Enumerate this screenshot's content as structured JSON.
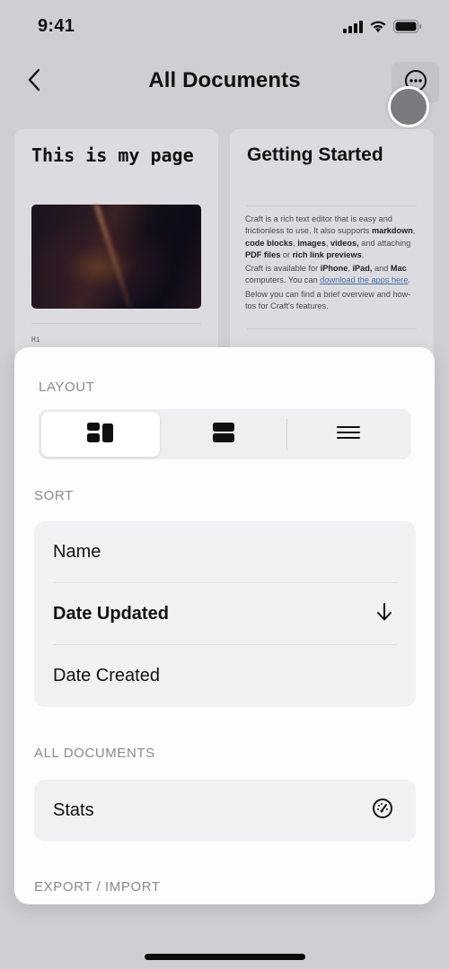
{
  "status_bar": {
    "time": "9:41",
    "icons": [
      "cellular-signal-icon",
      "wifi-icon",
      "battery-icon"
    ]
  },
  "nav": {
    "back_icon": "chevron-left-icon",
    "title": "All Documents",
    "more_icon": "ellipsis-circle-icon"
  },
  "documents": [
    {
      "title": "This is my page",
      "has_image": true,
      "snippet": "Hi"
    },
    {
      "title": "Getting Started",
      "body": {
        "p1_a": "Craft is a rich text editor that is easy and frictionless to use. It also supports ",
        "p1_b1": "markdown",
        "p1_c": ", ",
        "p1_b2": "code blocks",
        "p1_d": ", ",
        "p1_b3": "images",
        "p1_e": ", ",
        "p1_b4": "videos,",
        "p1_f": " and attaching ",
        "p1_b5": "PDF files",
        "p1_g": " or ",
        "p1_b6": "rich link previews",
        "p1_h": ".",
        "p2_a": "Craft is available for ",
        "p2_b1": "iPhone",
        "p2_c": ", ",
        "p2_b2": "iPad,",
        "p2_d": " and ",
        "p2_b3": "Mac",
        "p2_e": " computers. You can ",
        "p2_link": "download the apps here",
        "p2_f": ".",
        "p3": "Below you can find a brief overview and how-tos for Craft's features."
      }
    }
  ],
  "sheet": {
    "layout": {
      "label": "LAYOUT",
      "options": [
        {
          "name": "grid",
          "icon": "grid-layout-icon",
          "selected": true
        },
        {
          "name": "cards",
          "icon": "cards-layout-icon",
          "selected": false
        },
        {
          "name": "list",
          "icon": "list-layout-icon",
          "selected": false
        }
      ]
    },
    "sort": {
      "label": "SORT",
      "options": [
        {
          "label": "Name",
          "selected": false
        },
        {
          "label": "Date Updated",
          "selected": true,
          "direction_icon": "arrow-down-icon"
        },
        {
          "label": "Date Created",
          "selected": false
        }
      ]
    },
    "all_documents": {
      "label": "ALL DOCUMENTS",
      "items": [
        {
          "label": "Stats",
          "icon": "speedometer-icon"
        }
      ]
    },
    "export_import": {
      "label": "EXPORT / IMPORT"
    }
  }
}
